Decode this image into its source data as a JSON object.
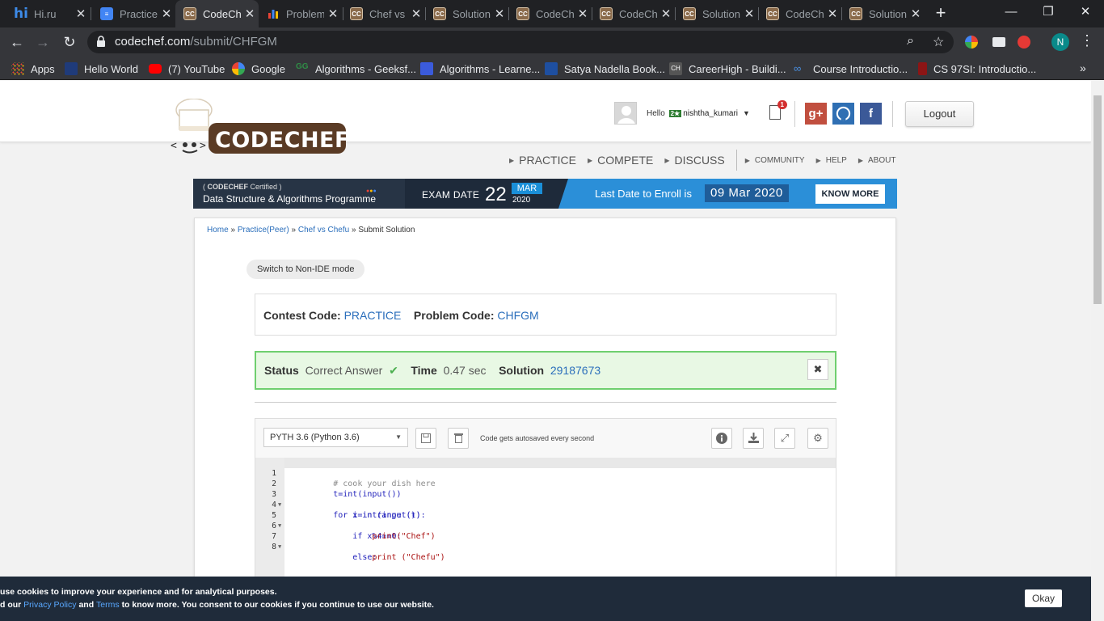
{
  "browser": {
    "tabs": [
      {
        "label": "Hi.ru",
        "icon": "hi-icon"
      },
      {
        "label": "Practice",
        "icon": "docs-icon"
      },
      {
        "label": "CodeChef",
        "icon": "codechef-icon",
        "active": true
      },
      {
        "label": "Problem",
        "icon": "bars-icon"
      },
      {
        "label": "Chef vs",
        "icon": "codechef-icon"
      },
      {
        "label": "Solution",
        "icon": "codechef-icon"
      },
      {
        "label": "CodeChef",
        "icon": "codechef-icon"
      },
      {
        "label": "CodeChef",
        "icon": "codechef-icon"
      },
      {
        "label": "Solution",
        "icon": "codechef-icon"
      },
      {
        "label": "CodeChef",
        "icon": "codechef-icon"
      },
      {
        "label": "Solution",
        "icon": "codechef-icon"
      }
    ],
    "url_host": "codechef.com",
    "url_path": "/submit/CHFGM",
    "profile_initial": "N",
    "bookmarks": [
      {
        "label": "Apps",
        "icon": "apps-grid-icon"
      },
      {
        "label": "Hello World",
        "icon": "bookmark-icon"
      },
      {
        "label": "(7) YouTube",
        "icon": "youtube-icon"
      },
      {
        "label": "Google",
        "icon": "google-icon"
      },
      {
        "label": "Algorithms - Geeksf...",
        "icon": "geeksforgeeks-icon"
      },
      {
        "label": "Algorithms - Learne...",
        "icon": "learner-icon"
      },
      {
        "label": "Satya Nadella Book...",
        "icon": "book-icon"
      },
      {
        "label": "CareerHigh - Buildi...",
        "icon": "careerhigh-icon"
      },
      {
        "label": "Course Introductio...",
        "icon": "coursera-icon"
      },
      {
        "label": "CS 97SI: Introductio...",
        "icon": "stanford-icon"
      }
    ]
  },
  "header": {
    "logo_text": "CODECHEF",
    "hello": "Hello",
    "star_badge": "2★",
    "username": "nishtha_kumari",
    "notification_count": "1",
    "logout": "Logout"
  },
  "nav": {
    "items": [
      {
        "label": "PRACTICE"
      },
      {
        "label": "COMPETE"
      },
      {
        "label": "DISCUSS"
      },
      {
        "label": "COMMUNITY"
      },
      {
        "label": "HELP"
      },
      {
        "label": "ABOUT"
      }
    ]
  },
  "banner": {
    "brand": "CODECHEF",
    "certified": "Certified",
    "program": "Data Structure & Algorithms Programme",
    "exam_label": "EXAM DATE",
    "exam_day": "22",
    "exam_month": "MAR",
    "exam_year": "2020",
    "enroll_label": "Last Date to Enroll is",
    "enroll_date": "09 Mar 2020",
    "cta": "KNOW MORE"
  },
  "breadcrumb": {
    "home": "Home",
    "practice": "Practice(Peer)",
    "problem": "Chef vs Chefu",
    "current": "Submit Solution",
    "sep": "»"
  },
  "switch_mode": "Switch to Non-IDE mode",
  "contest": {
    "contest_label": "Contest Code:",
    "contest_value": "PRACTICE",
    "problem_label": "Problem Code:",
    "problem_value": "CHFGM"
  },
  "status": {
    "status_label": "Status",
    "status_value": "Correct Answer",
    "time_label": "Time",
    "time_value": "0.47 sec",
    "solution_label": "Solution",
    "solution_value": "29187673"
  },
  "editor": {
    "language": "PYTH 3.6 (Python 3.6)",
    "autosave": "Code gets autosaved every second",
    "lines": [
      "# cook your dish here",
      "t=int(input())",
      "for i in range (t):",
      "    x=int(input())",
      "    if x%4==0:",
      "        print(\"Chef\")",
      "    else:",
      "        print (\"Chefu\")"
    ],
    "line_numbers": [
      "1",
      "2",
      "3",
      "4",
      "5",
      "6",
      "7",
      "8"
    ]
  },
  "cookie": {
    "line1": "use cookies to improve your experience and for analytical purposes.",
    "line2_a": "d our",
    "privacy": "Privacy Policy",
    "and": "and",
    "terms": "Terms",
    "line2_b": "to know more. You consent to our cookies if you continue to use our website.",
    "okay": "Okay"
  },
  "colors": {
    "chrome_dark": "#202124",
    "link_blue": "#2a6ebb",
    "status_green": "#6fcf6f",
    "banner_blue": "#2b8fd8"
  }
}
